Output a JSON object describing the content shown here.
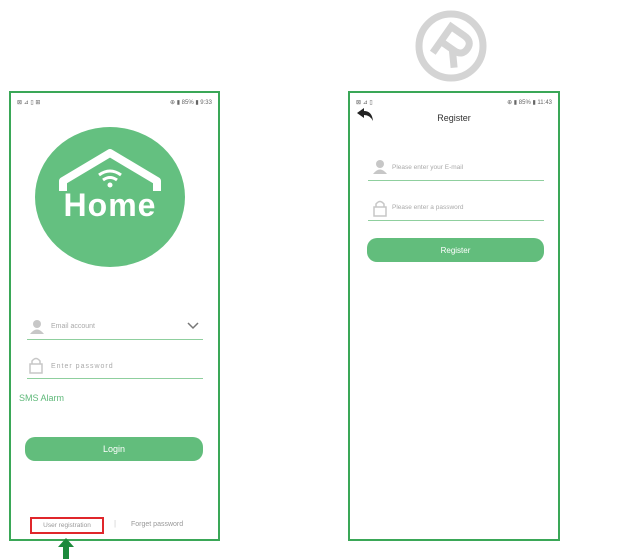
{
  "watermark": {
    "icon": "registered-icon"
  },
  "login_screen": {
    "status_left": "⊠ ⊿ ▯ ⊞",
    "status_right": "⊕ ▮ 85% ▮ 9:33",
    "logo_text": "Home",
    "logo_color": "#64c080",
    "email_placeholder": "Email account",
    "password_placeholder": "Enter password",
    "sms_alarm": "SMS Alarm",
    "login_label": "Login",
    "user_registration": "User registration",
    "separator": "|",
    "forget_password": "Forget password"
  },
  "register_screen": {
    "status_left": "⊠ ⊿ ▯",
    "status_right": "⊕ ▮ 85% ▮ 11:43",
    "title": "Register",
    "email_placeholder": "Please enter your E-mail",
    "password_placeholder": "Please enter a password",
    "register_label": "Register"
  },
  "colors": {
    "accent": "#3aa757",
    "highlight": "#e0262b",
    "arrow": "#1c8a3c"
  }
}
